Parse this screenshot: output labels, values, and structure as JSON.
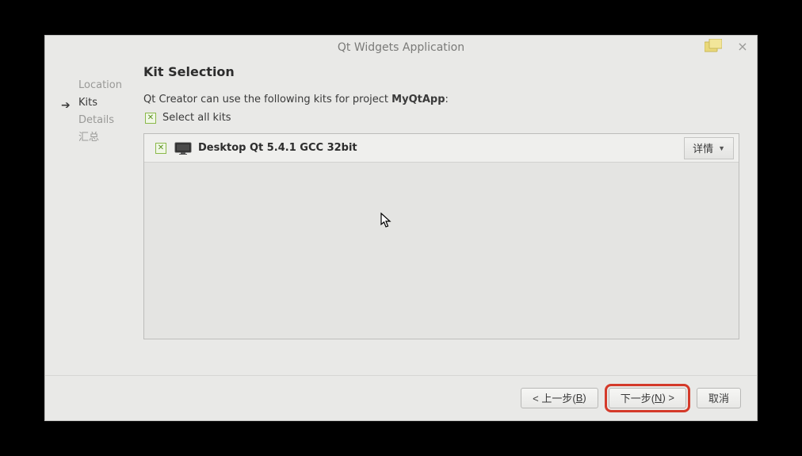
{
  "titlebar": {
    "title": "Qt Widgets Application"
  },
  "sidebar": {
    "items": [
      {
        "label": "Location"
      },
      {
        "label": "Kits"
      },
      {
        "label": "Details"
      },
      {
        "label": "汇总"
      }
    ]
  },
  "main": {
    "heading": "Kit Selection",
    "desc_prefix": "Qt Creator can use the following kits for project ",
    "project_name": "MyQtApp",
    "desc_suffix": ":",
    "select_all_label": "Select all kits",
    "kits": [
      {
        "name": "Desktop Qt 5.4.1 GCC 32bit",
        "details_label": "详情"
      }
    ]
  },
  "footer": {
    "back_pre": "< 上一步(",
    "back_key": "B",
    "back_post": ")",
    "next_pre": "下一步(",
    "next_key": "N",
    "next_post": ") >",
    "cancel": "取消"
  }
}
